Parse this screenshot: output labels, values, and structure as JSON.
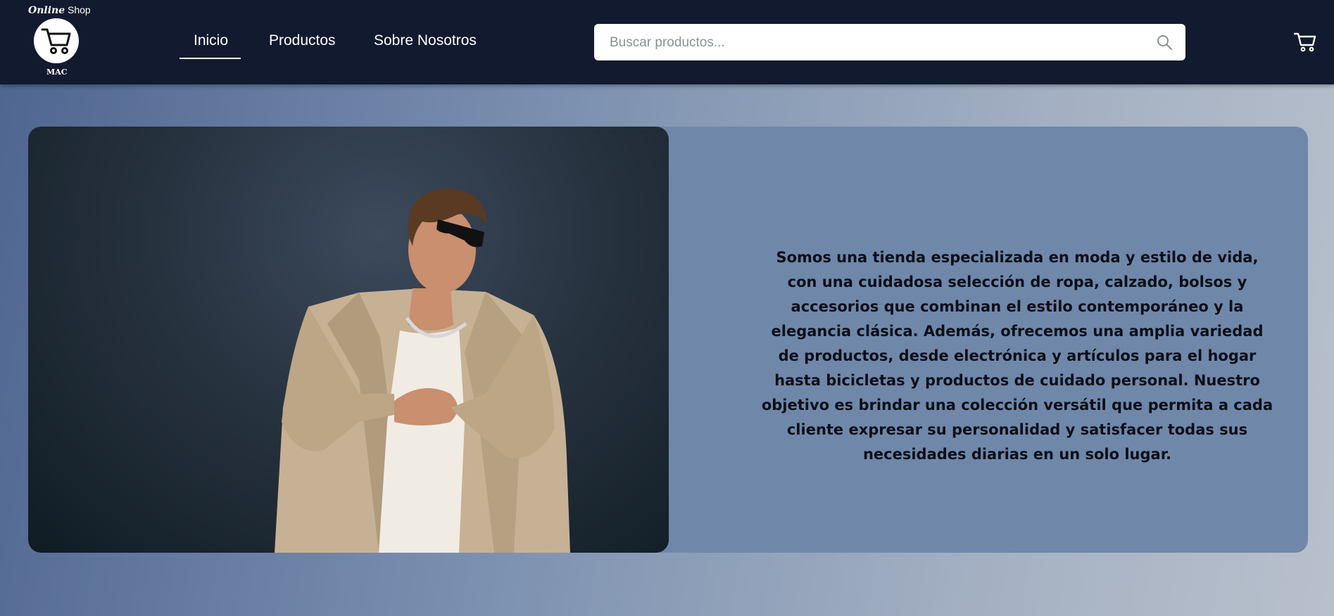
{
  "logo": {
    "top_bold": "Online",
    "top_text": "Shop",
    "bottom_text": "MAC",
    "icon": "shopping-cart-icon"
  },
  "nav": {
    "items": [
      {
        "label": "Inicio",
        "active": true
      },
      {
        "label": "Productos",
        "active": false
      },
      {
        "label": "Sobre Nosotros",
        "active": false
      }
    ]
  },
  "search": {
    "placeholder": "Buscar productos...",
    "value": "",
    "icon": "search-icon"
  },
  "header": {
    "cart_icon": "shopping-cart-icon",
    "background": "#111a2e"
  },
  "hero": {
    "image": "man-in-beige-trench-coat-photo",
    "about_text": "Somos una tienda especializada en moda y estilo de vida, con una cuidadosa selección de ropa, calzado, bolsos y accesorios que combinan el estilo contemporáneo y la elegancia clásica. Además, ofrecemos una amplia variedad de productos, desde electrónica y artículos para el hogar hasta bicicletas y productos de cuidado personal. Nuestro objetivo es brindar una colección versátil que permita a cada cliente expresar su personalidad y satisfacer todas sus necesidades diarias en un solo lugar.",
    "card_color": "#6f88aa"
  }
}
